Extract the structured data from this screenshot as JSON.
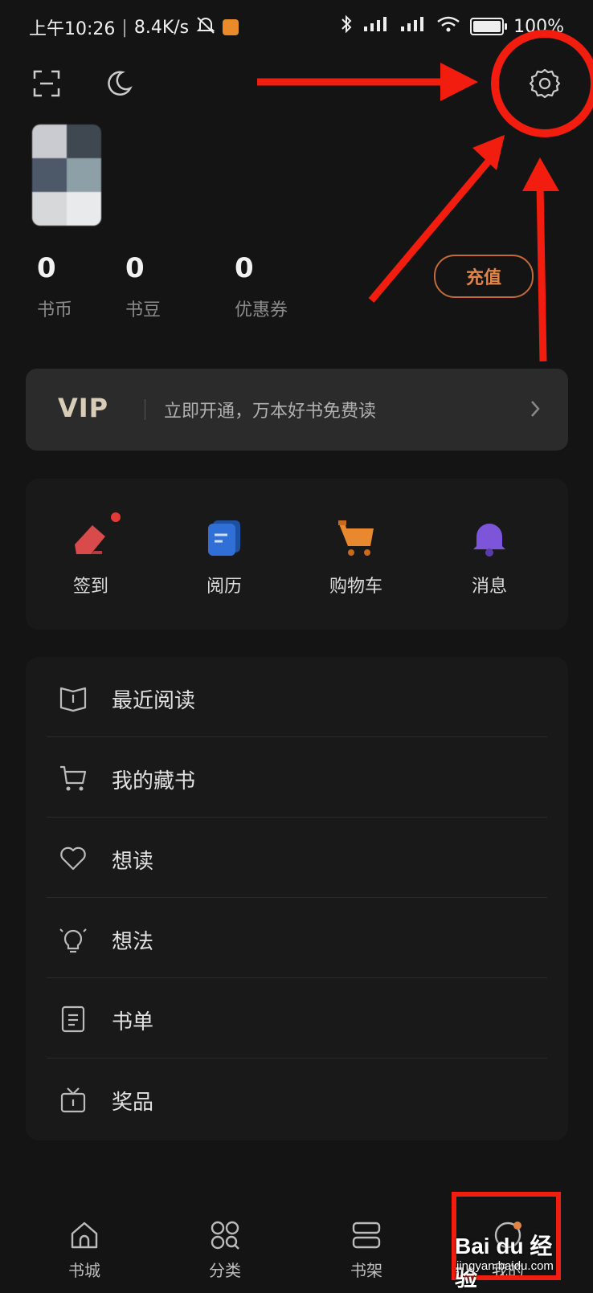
{
  "status_bar": {
    "time": "上午10:26",
    "net_speed": "8.4K/s",
    "battery": "100%"
  },
  "profile": {
    "stats": [
      {
        "value": "0",
        "label": "书币"
      },
      {
        "value": "0",
        "label": "书豆"
      },
      {
        "value": "0",
        "label": "优惠券"
      }
    ],
    "recharge_label": "充值"
  },
  "vip_banner": {
    "logo": "VIP",
    "text": "立即开通，万本好书免费读"
  },
  "quick_actions": [
    {
      "label": "签到",
      "icon": "checkin-icon",
      "color": "#d94a4a",
      "has_dot": true
    },
    {
      "label": "阅历",
      "icon": "history-icon",
      "color": "#2f6fd6",
      "has_dot": false
    },
    {
      "label": "购物车",
      "icon": "cart-icon",
      "color": "#e8892f",
      "has_dot": false
    },
    {
      "label": "消息",
      "icon": "bell-icon",
      "color": "#7d55d9",
      "has_dot": false
    }
  ],
  "menu": [
    {
      "label": "最近阅读",
      "icon": "book-open-icon"
    },
    {
      "label": "我的藏书",
      "icon": "cart-outline-icon"
    },
    {
      "label": "想读",
      "icon": "heart-icon"
    },
    {
      "label": "想法",
      "icon": "lightbulb-icon"
    },
    {
      "label": "书单",
      "icon": "list-icon"
    },
    {
      "label": "奖品",
      "icon": "gift-icon"
    }
  ],
  "tabbar": {
    "tabs": [
      {
        "label": "书城",
        "icon": "home-icon"
      },
      {
        "label": "分类",
        "icon": "category-icon"
      },
      {
        "label": "书架",
        "icon": "shelf-icon"
      },
      {
        "label": "我的",
        "icon": "profile-icon",
        "active": true
      }
    ]
  },
  "watermark": {
    "brand": "Bai du 经验",
    "url": "jingyan.baidu.com"
  },
  "colors": {
    "background": "#141414",
    "annotation_red": "#f21d0f",
    "accent_orange": "#e08448"
  }
}
